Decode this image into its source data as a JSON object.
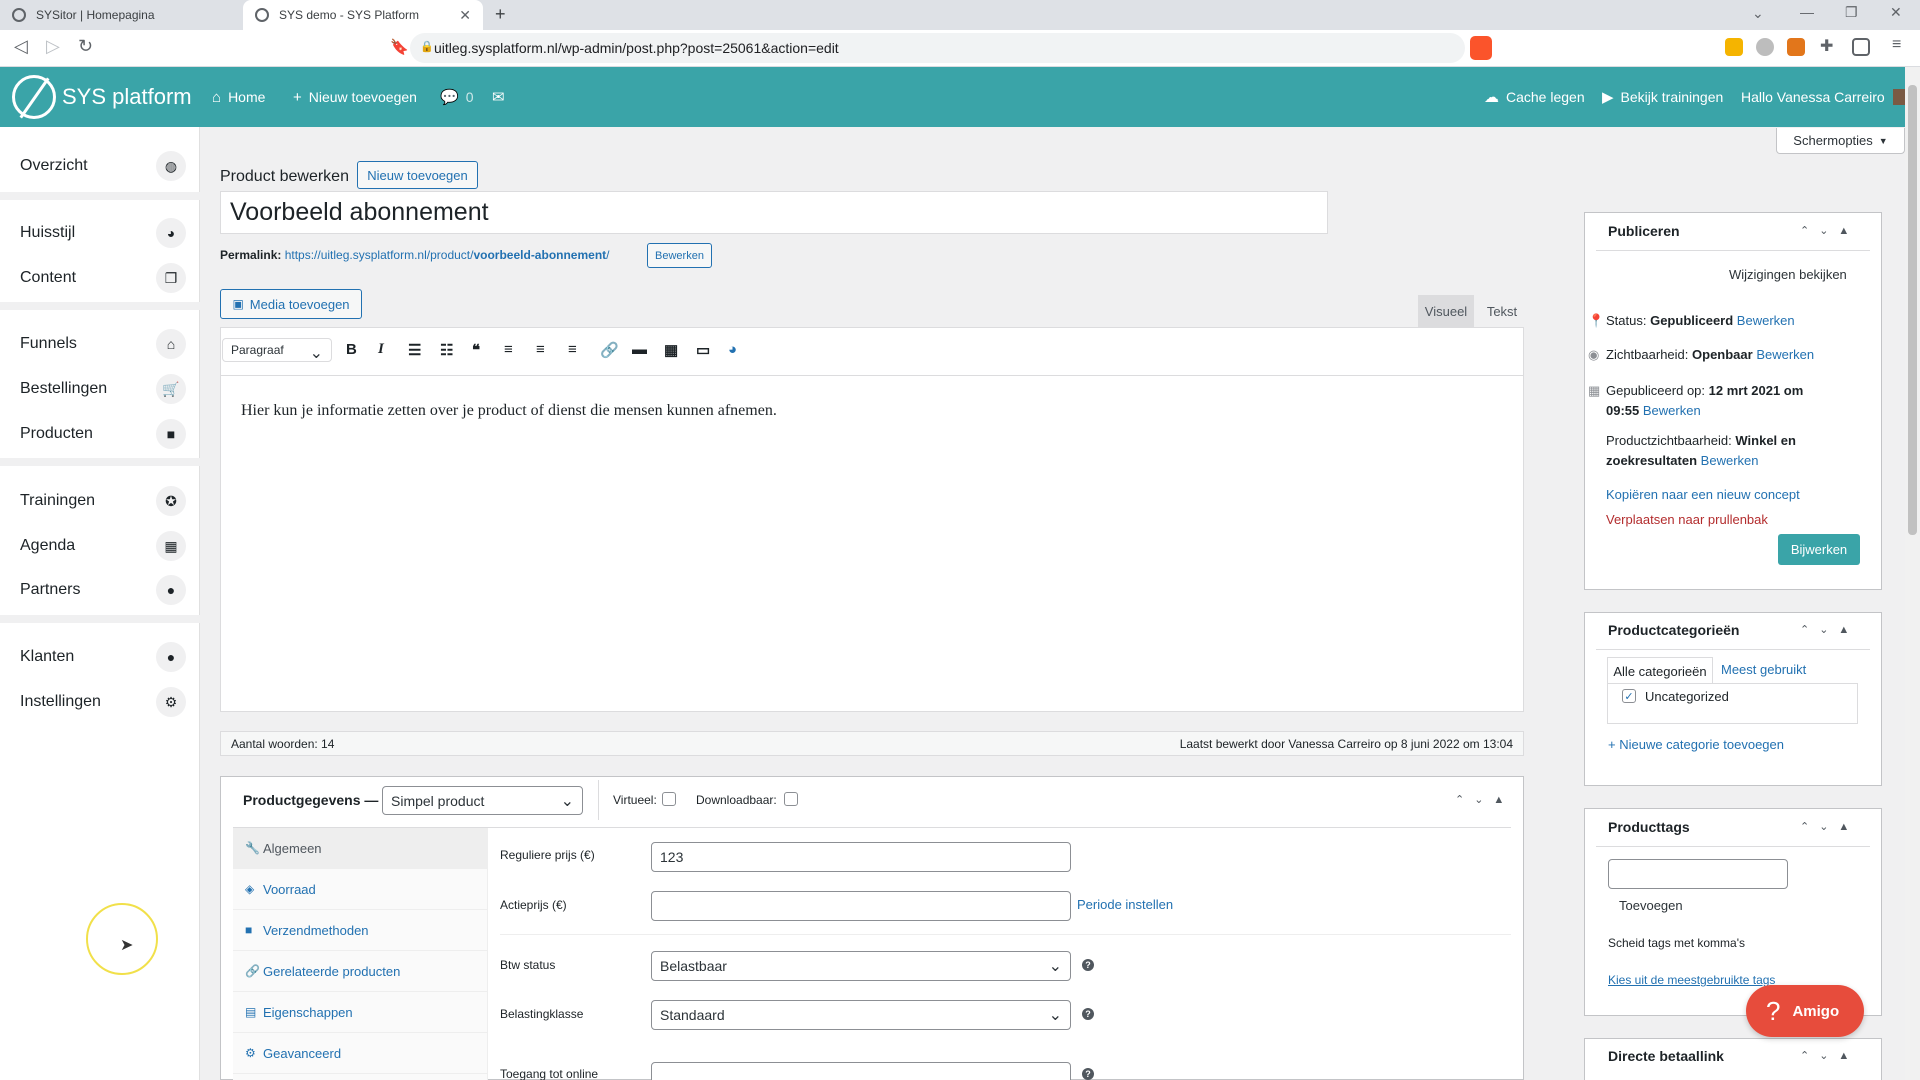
{
  "browser": {
    "tabs": [
      {
        "title": "SYSitor | Homepagina"
      },
      {
        "title": "SYS demo - SYS Platform"
      }
    ],
    "url": "uitleg.sysplatform.nl/wp-admin/post.php?post=25061&action=edit",
    "new_tab": "+"
  },
  "adminbar": {
    "logo_text": "SYS platform",
    "home": "Home",
    "new": "Nieuw toevoegen",
    "comments_count": "0",
    "cache": "Cache legen",
    "trainings": "Bekijk trainingen",
    "greeting": "Hallo Vanessa Carreiro"
  },
  "sidebar": {
    "items": [
      {
        "label": "Overzicht",
        "icon": "globe-icon"
      },
      {
        "label": "Huisstijl",
        "icon": "palette-icon"
      },
      {
        "label": "Content",
        "icon": "copy-icon"
      },
      {
        "label": "Funnels",
        "icon": "store-icon"
      },
      {
        "label": "Bestellingen",
        "icon": "cart-icon"
      },
      {
        "label": "Producten",
        "icon": "bag-icon"
      },
      {
        "label": "Trainingen",
        "icon": "award-icon"
      },
      {
        "label": "Agenda",
        "icon": "calendar-icon"
      },
      {
        "label": "Partners",
        "icon": "user-icon"
      },
      {
        "label": "Klanten",
        "icon": "user-icon"
      },
      {
        "label": "Instellingen",
        "icon": "gear-icon"
      }
    ]
  },
  "screen_options": "Schermopties",
  "editor": {
    "heading": "Product bewerken",
    "add_new": "Nieuw toevoegen",
    "title_value": "Voorbeeld abonnement",
    "permalink_label": "Permalink:",
    "permalink_base": "https://uitleg.sysplatform.nl/product/",
    "permalink_slug": "voorbeeld-abonnement",
    "permalink_suffix": "/",
    "permalink_edit": "Bewerken",
    "media_button": "Media toevoegen",
    "tab_visual": "Visueel",
    "tab_text": "Tekst",
    "format_select": "Paragraaf",
    "content": "Hier kun je informatie zetten over je product of dienst die mensen kunnen afnemen.",
    "word_count": "Aantal woorden: 14",
    "last_edited": "Laatst bewerkt door Vanessa Carreiro op 8 juni 2022 om 13:04"
  },
  "product_data": {
    "title": "Productgegevens —",
    "type_select": "Simpel product",
    "virtual_label": "Virtueel:",
    "downloadable_label": "Downloadbaar:",
    "tabs": [
      "Algemeen",
      "Voorraad",
      "Verzendmethoden",
      "Gerelateerde producten",
      "Eigenschappen",
      "Geavanceerd"
    ],
    "regular_price_label": "Reguliere prijs (€)",
    "regular_price_value": "123",
    "sale_price_label": "Actieprijs (€)",
    "schedule_link": "Periode instellen",
    "tax_status_label": "Btw status",
    "tax_status_value": "Belastbaar",
    "tax_class_label": "Belastingklasse",
    "tax_class_value": "Standaard",
    "online_access_label": "Toegang tot online"
  },
  "publish": {
    "title": "Publiceren",
    "preview": "Wijzigingen bekijken",
    "status_label": "Status:",
    "status_value": "Gepubliceerd",
    "visibility_label": "Zichtbaarheid:",
    "visibility_value": "Openbaar",
    "published_label": "Gepubliceerd op:",
    "published_value_1": "12 mrt 2021 om",
    "published_value_2": "09:55",
    "product_visibility_label": "Productzichtbaarheid:",
    "product_visibility_value_1": "Winkel en",
    "product_visibility_value_2": "zoekresultaten",
    "edit": "Bewerken",
    "copy_draft": "Kopiëren naar een nieuw concept",
    "trash": "Verplaatsen naar prullenbak",
    "update": "Bijwerken"
  },
  "categories": {
    "title": "Productcategorieën",
    "tab_all": "Alle categorieën",
    "tab_most_used": "Meest gebruikt",
    "item": "Uncategorized",
    "add_new": "+ Nieuwe categorie toevoegen"
  },
  "tags": {
    "title": "Producttags",
    "add": "Toevoegen",
    "hint": "Scheid tags met komma's",
    "choose": "Kies uit de meestgebruikte tags"
  },
  "direct_link": {
    "title": "Directe betaallink"
  },
  "amigo": {
    "label": "Amigo"
  },
  "colors": {
    "accent": "#3aa4a8",
    "link": "#2271b1",
    "trash": "#b32d2e",
    "amigo": "#e74c3c"
  }
}
